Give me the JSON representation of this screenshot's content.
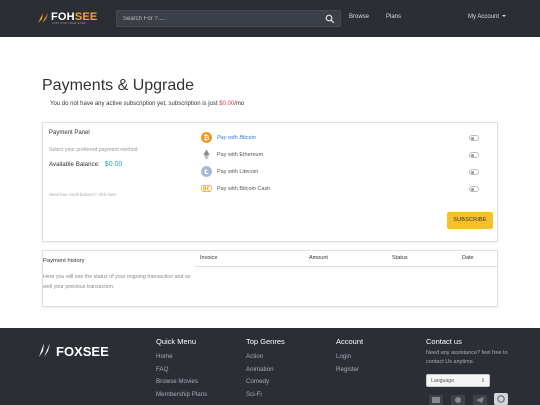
{
  "header": {
    "logo_part1": "FOH",
    "logo_part2": "SEE",
    "logo_tagline": "JUST FOR YOUR EYES",
    "search_placeholder": "Search For ?.....",
    "nav_browse": "Browse",
    "nav_plans": "Plans",
    "account_label": "My Account"
  },
  "page": {
    "title": "Payments & Upgrade",
    "subscription_text": "You do not have any active subscription yet, subscription is just ",
    "subscription_price": "$0.00",
    "subscription_suffix": "/mo"
  },
  "payment_panel": {
    "title": "Payment Panel",
    "description": "Select your preferred payment method",
    "balance_label": "Available Balance:",
    "balance_value": "$0.00",
    "free_credit": "Need free credit balance? click here",
    "options": [
      {
        "label": "Pay with Bitcoin",
        "icon": "bitcoin-icon",
        "selected": true
      },
      {
        "label": "Pay with Ethereum",
        "icon": "ethereum-icon",
        "selected": false
      },
      {
        "label": "Pay with Litecoin",
        "icon": "litecoin-icon",
        "selected": false
      },
      {
        "label": "Pay with Bitcoin Cash",
        "icon": "bitcoin-cash-icon",
        "selected": false
      }
    ],
    "subscribe_label": "SUBSCRIBE"
  },
  "history": {
    "title": "Payment history",
    "description": "Here you will see the status of your ongoing transaction and as well your previous transaction.",
    "columns": [
      "Invoice",
      "Amount",
      "Status",
      "Date"
    ]
  },
  "footer": {
    "logo": "FOXSEE",
    "quick_menu": {
      "title": "Quick Menu",
      "items": [
        "Home",
        "FAQ",
        "Browse Movies",
        "Membership Plans"
      ]
    },
    "top_genres": {
      "title": "Top Genres",
      "items": [
        "Action",
        "Animation",
        "Comedy",
        "Sci-Fi"
      ]
    },
    "account": {
      "title": "Account",
      "items": [
        "Login",
        "Register"
      ]
    },
    "contact": {
      "title": "Contact us",
      "text": "Need any assistance? feel free to contact Us anytime.",
      "language_placeholder": "Language"
    }
  },
  "colors": {
    "accent": "#f5c02a",
    "brand_orange": "#f0a32a",
    "price_red": "#e53935",
    "balance_blue": "#26a5c4",
    "dark_bg": "#2b2f35"
  }
}
